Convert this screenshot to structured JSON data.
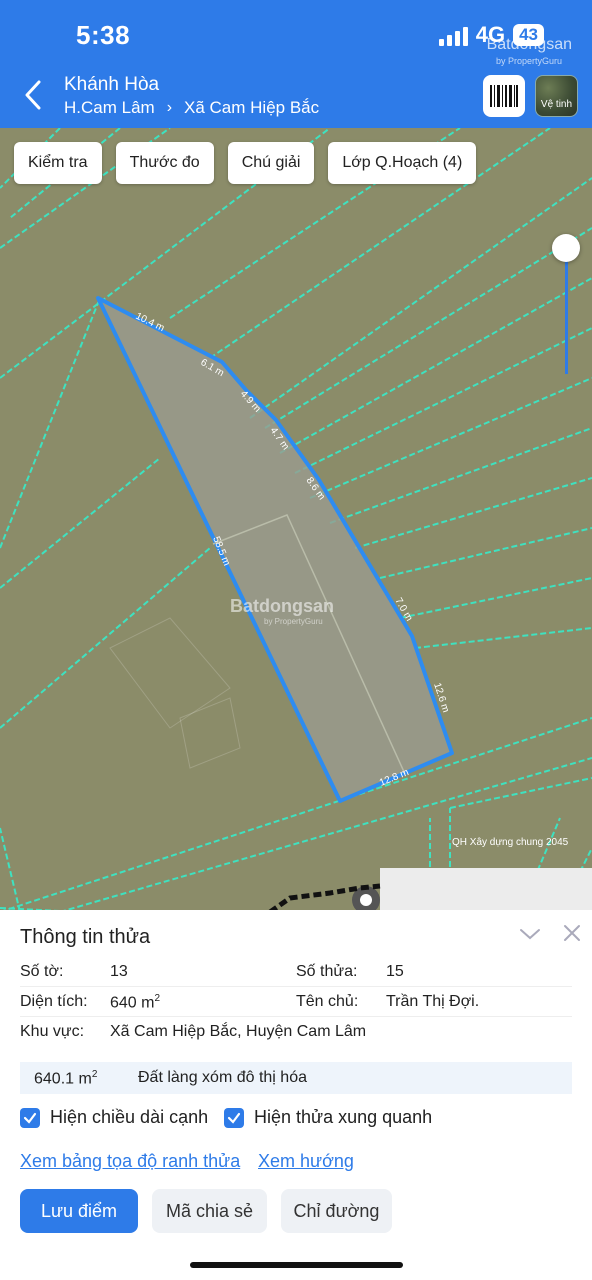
{
  "status": {
    "time": "5:38",
    "network": "4G",
    "battery": "43"
  },
  "brand": {
    "name": "Batdongsan",
    "sub": "by PropertyGuru"
  },
  "header": {
    "province": "Khánh Hòa",
    "district": "H.Cam Lâm",
    "commune": "Xã Cam Hiệp Bắc",
    "satellite_label": "Vệ tinh"
  },
  "map": {
    "buttons": [
      "Kiểm tra",
      "Thước đo",
      "Chú giải",
      "Lớp Q.Hoạch (4)"
    ],
    "edge_lengths": [
      "10.4 m",
      "6.1 m",
      "4.9 m",
      "4.7 m",
      "8.6 m",
      "7.0 m",
      "12.6 m",
      "12.8 m",
      "58.5 m"
    ],
    "plan_label": "QH Xây dựng chung 2045",
    "colors": {
      "land": "#8b8c69",
      "grid": "#3ee2c0",
      "parcel_stroke": "#2e8cf0",
      "parcel_fill": "#9a9b8f"
    }
  },
  "parcel": {
    "title": "Thông tin thửa",
    "so_to_label": "Số tờ:",
    "so_to": "13",
    "so_thua_label": "Số thửa:",
    "so_thua": "15",
    "dien_tich_label": "Diện tích:",
    "dien_tich": "640 m",
    "ten_chu_label": "Tên chủ:",
    "ten_chu": "Trần Thị Đợi.",
    "khu_vuc_label": "Khu vực:",
    "khu_vuc": "Xã Cam Hiệp Bắc, Huyện Cam Lâm",
    "land_area": "640.1 m",
    "land_type": "Đất làng xóm đô thị hóa",
    "sup": "2"
  },
  "options": {
    "show_edge_length": "Hiện chiều dài cạnh",
    "show_surrounding": "Hiện thửa xung quanh"
  },
  "links": {
    "coords": "Xem bảng tọa độ ranh thửa",
    "direction": "Xem hướng"
  },
  "actions": {
    "save": "Lưu điểm",
    "share": "Mã chia sẻ",
    "route": "Chỉ đường"
  }
}
